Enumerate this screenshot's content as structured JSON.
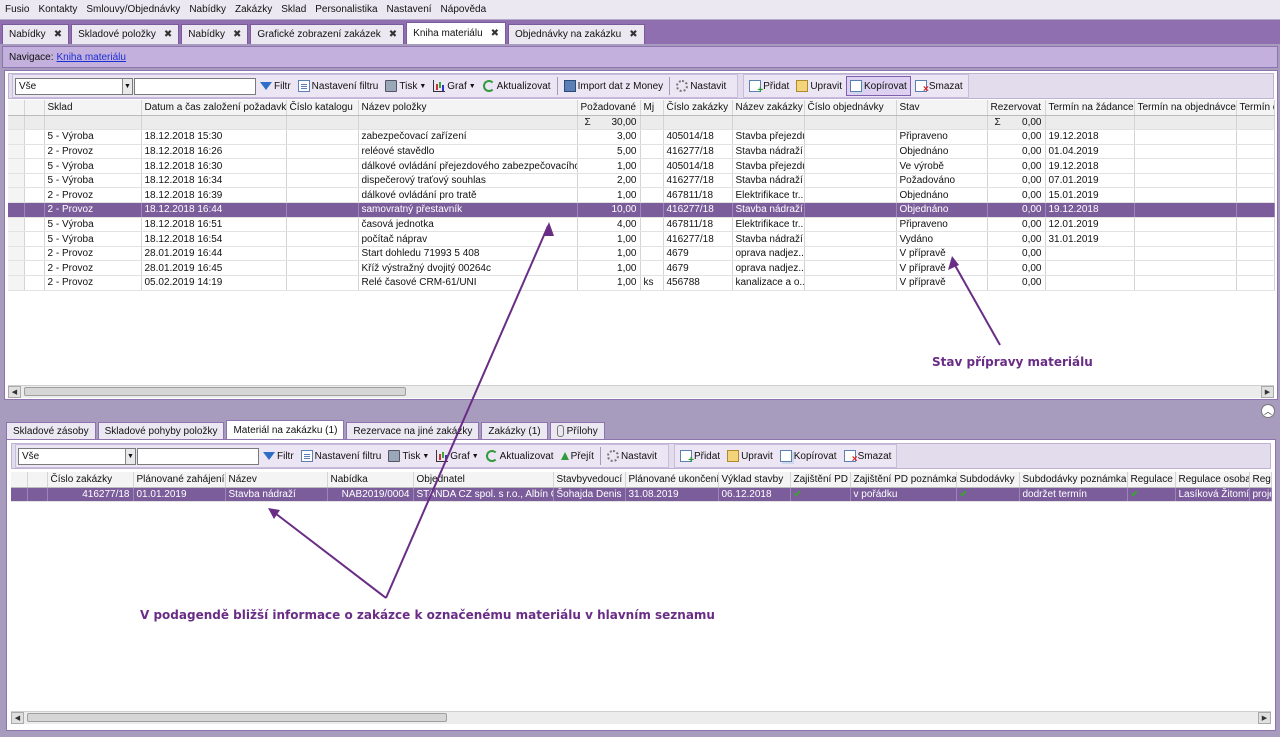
{
  "menu": [
    "Fusio",
    "Kontakty",
    "Smlouvy/Objednávky",
    "Nabídky",
    "Zakázky",
    "Sklad",
    "Personalistika",
    "Nastavení",
    "Nápověda"
  ],
  "tabs": [
    {
      "label": "Nabídky",
      "active": false
    },
    {
      "label": "Skladové položky",
      "active": false
    },
    {
      "label": "Nabídky",
      "active": false
    },
    {
      "label": "Grafické zobrazení zakázek",
      "active": false
    },
    {
      "label": "Kniha materiálu",
      "active": true
    },
    {
      "label": "Objednávky na zakázku",
      "active": false
    }
  ],
  "navigation": {
    "label": "Navigace:",
    "link": "Kniha materiálu"
  },
  "toolbar": {
    "filter_value": "Vše",
    "filter": "Filtr",
    "filter_settings": "Nastavení filtru",
    "print": "Tisk",
    "chart": "Graf",
    "refresh": "Aktualizovat",
    "import": "Import dat z Money",
    "setup": "Nastavit",
    "add": "Přidat",
    "edit": "Upravit",
    "copy": "Kopírovat",
    "delete": "Smazat"
  },
  "main_grid": {
    "columns": [
      "Sklad",
      "Datum a čas založení požadavku",
      "Číslo katalogu",
      "Název položky",
      "Požadované",
      "Mj",
      "Číslo zakázky",
      "Název zakázky",
      "Číslo objednávky",
      "Stav",
      "Rezervovat",
      "Termín na žádance",
      "Termín na objednávce",
      "Termín do"
    ],
    "summary": {
      "sigma": "Σ",
      "pozadovane_total": "30,00",
      "rezervovat_total": "0,00"
    },
    "rows": [
      [
        "5 - Výroba",
        "18.12.2018 15:30",
        "",
        "zabezpečovací zařízení",
        "3,00",
        "",
        "405014/18",
        "Stavba přejezdu",
        "",
        "Připraveno",
        "0,00",
        "19.12.2018",
        "",
        ""
      ],
      [
        "2 - Provoz",
        "18.12.2018 16:26",
        "",
        "reléové stavědlo",
        "5,00",
        "",
        "416277/18",
        "Stavba nádraží",
        "",
        "Objednáno",
        "0,00",
        "01.04.2019",
        "",
        ""
      ],
      [
        "5 - Výroba",
        "18.12.2018 16:30",
        "",
        "dálkové ovládání přejezdového zabezpečovacího zaří",
        "1,00",
        "",
        "405014/18",
        "Stavba přejezdu",
        "",
        "Ve výrobě",
        "0,00",
        "19.12.2018",
        "",
        ""
      ],
      [
        "5 - Výroba",
        "18.12.2018 16:34",
        "",
        "dispečerový traťový souhlas",
        "2,00",
        "",
        "416277/18",
        "Stavba nádraží",
        "",
        "Požadováno",
        "0,00",
        "07.01.2019",
        "",
        ""
      ],
      [
        "2 - Provoz",
        "18.12.2018 16:39",
        "",
        "dálkové ovládání pro tratě",
        "1,00",
        "",
        "467811/18",
        "Elektrifikace tr...",
        "",
        "Objednáno",
        "0,00",
        "15.01.2019",
        "",
        ""
      ],
      [
        "2 - Provoz",
        "18.12.2018 16:44",
        "",
        "samovratný přestavník",
        "10,00",
        "",
        "416277/18",
        "Stavba nádraží",
        "",
        "Objednáno",
        "0,00",
        "19.12.2018",
        "",
        ""
      ],
      [
        "5 - Výroba",
        "18.12.2018 16:51",
        "",
        "časová jednotka",
        "4,00",
        "",
        "467811/18",
        "Elektrifikace tr...",
        "",
        "Připraveno",
        "0,00",
        "12.01.2019",
        "",
        ""
      ],
      [
        "5 - Výroba",
        "18.12.2018 16:54",
        "",
        "počítač náprav",
        "1,00",
        "",
        "416277/18",
        "Stavba nádraží",
        "",
        "Vydáno",
        "0,00",
        "31.01.2019",
        "",
        ""
      ],
      [
        "2 - Provoz",
        "28.01.2019 16:44",
        "",
        "Start dohledu 71993 5  408",
        "1,00",
        "",
        "4679",
        "oprava nadjez...",
        "",
        "V přípravě",
        "0,00",
        "",
        "",
        ""
      ],
      [
        "2 - Provoz",
        "28.01.2019 16:45",
        "",
        "Kříž výstražný dvojitý   00264c",
        "1,00",
        "",
        "4679",
        "oprava nadjez...",
        "",
        "V přípravě",
        "0,00",
        "",
        "",
        ""
      ],
      [
        "2 - Provoz",
        "05.02.2019 14:19",
        "",
        "Relé časové CRM-61/UNI",
        "1,00",
        "ks",
        "456788",
        "kanalizace a o...",
        "",
        "V přípravě",
        "0,00",
        "",
        "",
        ""
      ]
    ],
    "selected_row": 5
  },
  "subtabs": [
    {
      "label": "Skladové zásoby",
      "active": false
    },
    {
      "label": "Skladové pohyby položky",
      "active": false
    },
    {
      "label": "Materiál na zakázku (1)",
      "active": true
    },
    {
      "label": "Rezervace na jiné zakázky",
      "active": false
    },
    {
      "label": "Zakázky (1)",
      "active": false
    },
    {
      "label": "Přílohy",
      "active": false
    }
  ],
  "subtoolbar": {
    "filter_value": "Vše",
    "filter": "Filtr",
    "filter_settings": "Nastavení filtru",
    "print": "Tisk",
    "chart": "Graf",
    "refresh": "Aktualizovat",
    "go": "Přejít",
    "setup": "Nastavit",
    "add": "Přidat",
    "edit": "Upravit",
    "copy": "Kopírovat",
    "delete": "Smazat"
  },
  "sub_grid": {
    "columns": [
      "Číslo zakázky",
      "Plánované zahájení",
      "Název",
      "Nabídka",
      "Objednatel",
      "Stavbyvedoucí",
      "Plánované ukončení",
      "Výklad stavby",
      "Zajištění PD",
      "Zajištění PD poznámka",
      "Subdodávky",
      "Subdodávky poznámka",
      "Regulace",
      "Regulace osoba",
      "Regu"
    ],
    "rows": [
      [
        "416277/18",
        "01.01.2019",
        "Stavba nádraží",
        "NAB2019/0004",
        "STANDA CZ spol. s r.o., Albín Čer...",
        "Šohajda Denis",
        "31.08.2019",
        "06.12.2018",
        "✔",
        "v pořádku",
        "✔",
        "dodržet termín",
        "✔",
        "Lasíková Žitomíra",
        "proje"
      ]
    ]
  },
  "annotations": {
    "status_note": "Stav přípravy materiálu",
    "detail_note": "V podagendě bližší informace o zakázce k označenému materiálu v hlavním seznamu"
  },
  "colors": {
    "accent": "#7c5d9c",
    "annotation": "#6a2d86",
    "check": "#2fae1f"
  }
}
